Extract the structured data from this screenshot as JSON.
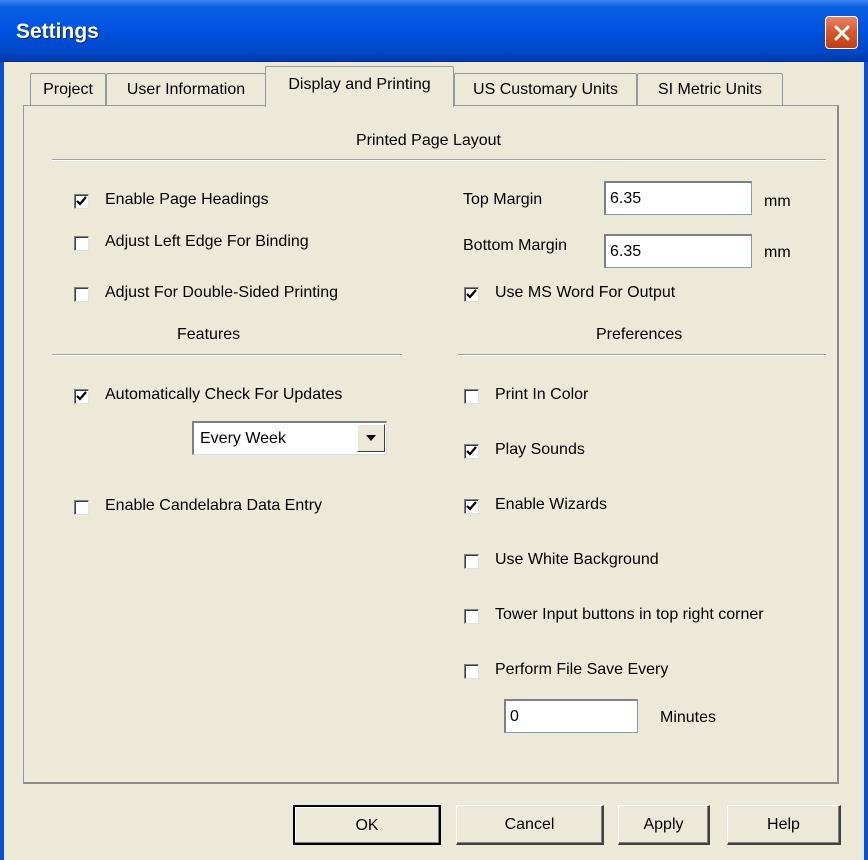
{
  "window": {
    "title": "Settings"
  },
  "tabs": [
    {
      "label": "Project"
    },
    {
      "label": "User Information"
    },
    {
      "label": "Display and Printing"
    },
    {
      "label": "US Customary Units"
    },
    {
      "label": "SI Metric Units"
    }
  ],
  "sections": {
    "printed_page_layout": "Printed Page Layout",
    "features": "Features",
    "preferences": "Preferences"
  },
  "page_layout": {
    "enable_page_headings": {
      "label": "Enable Page Headings",
      "checked": true
    },
    "adjust_left_edge": {
      "label": "Adjust Left Edge For Binding",
      "checked": false
    },
    "adjust_double_sided": {
      "label": "Adjust For Double-Sided Printing",
      "checked": false
    },
    "top_margin": {
      "label": "Top Margin",
      "value": "6.35",
      "unit": "mm"
    },
    "bottom_margin": {
      "label": "Bottom Margin",
      "value": "6.35",
      "unit": "mm"
    },
    "use_ms_word": {
      "label": "Use MS Word For Output",
      "checked": true
    }
  },
  "features": {
    "auto_check_updates": {
      "label": "Automatically Check For Updates",
      "checked": true
    },
    "update_frequency": {
      "value": "Every Week"
    },
    "candelabra_entry": {
      "label": "Enable Candelabra Data Entry",
      "checked": false
    }
  },
  "preferences": {
    "print_in_color": {
      "label": "Print In Color",
      "checked": false
    },
    "play_sounds": {
      "label": "Play Sounds",
      "checked": true
    },
    "enable_wizards": {
      "label": "Enable Wizards",
      "checked": true
    },
    "white_background": {
      "label": "Use White Background",
      "checked": false
    },
    "tower_input_buttons": {
      "label": "Tower Input buttons in top right corner",
      "checked": false
    },
    "file_save_every": {
      "label": "Perform File Save Every",
      "checked": false
    },
    "save_minutes": {
      "value": "0",
      "unit": "Minutes"
    }
  },
  "buttons": {
    "ok": "OK",
    "cancel": "Cancel",
    "apply": "Apply",
    "help": "Help"
  },
  "icons": {
    "close": "close-icon",
    "check": "check-mark-icon",
    "dropdown": "chevron-down-icon"
  }
}
